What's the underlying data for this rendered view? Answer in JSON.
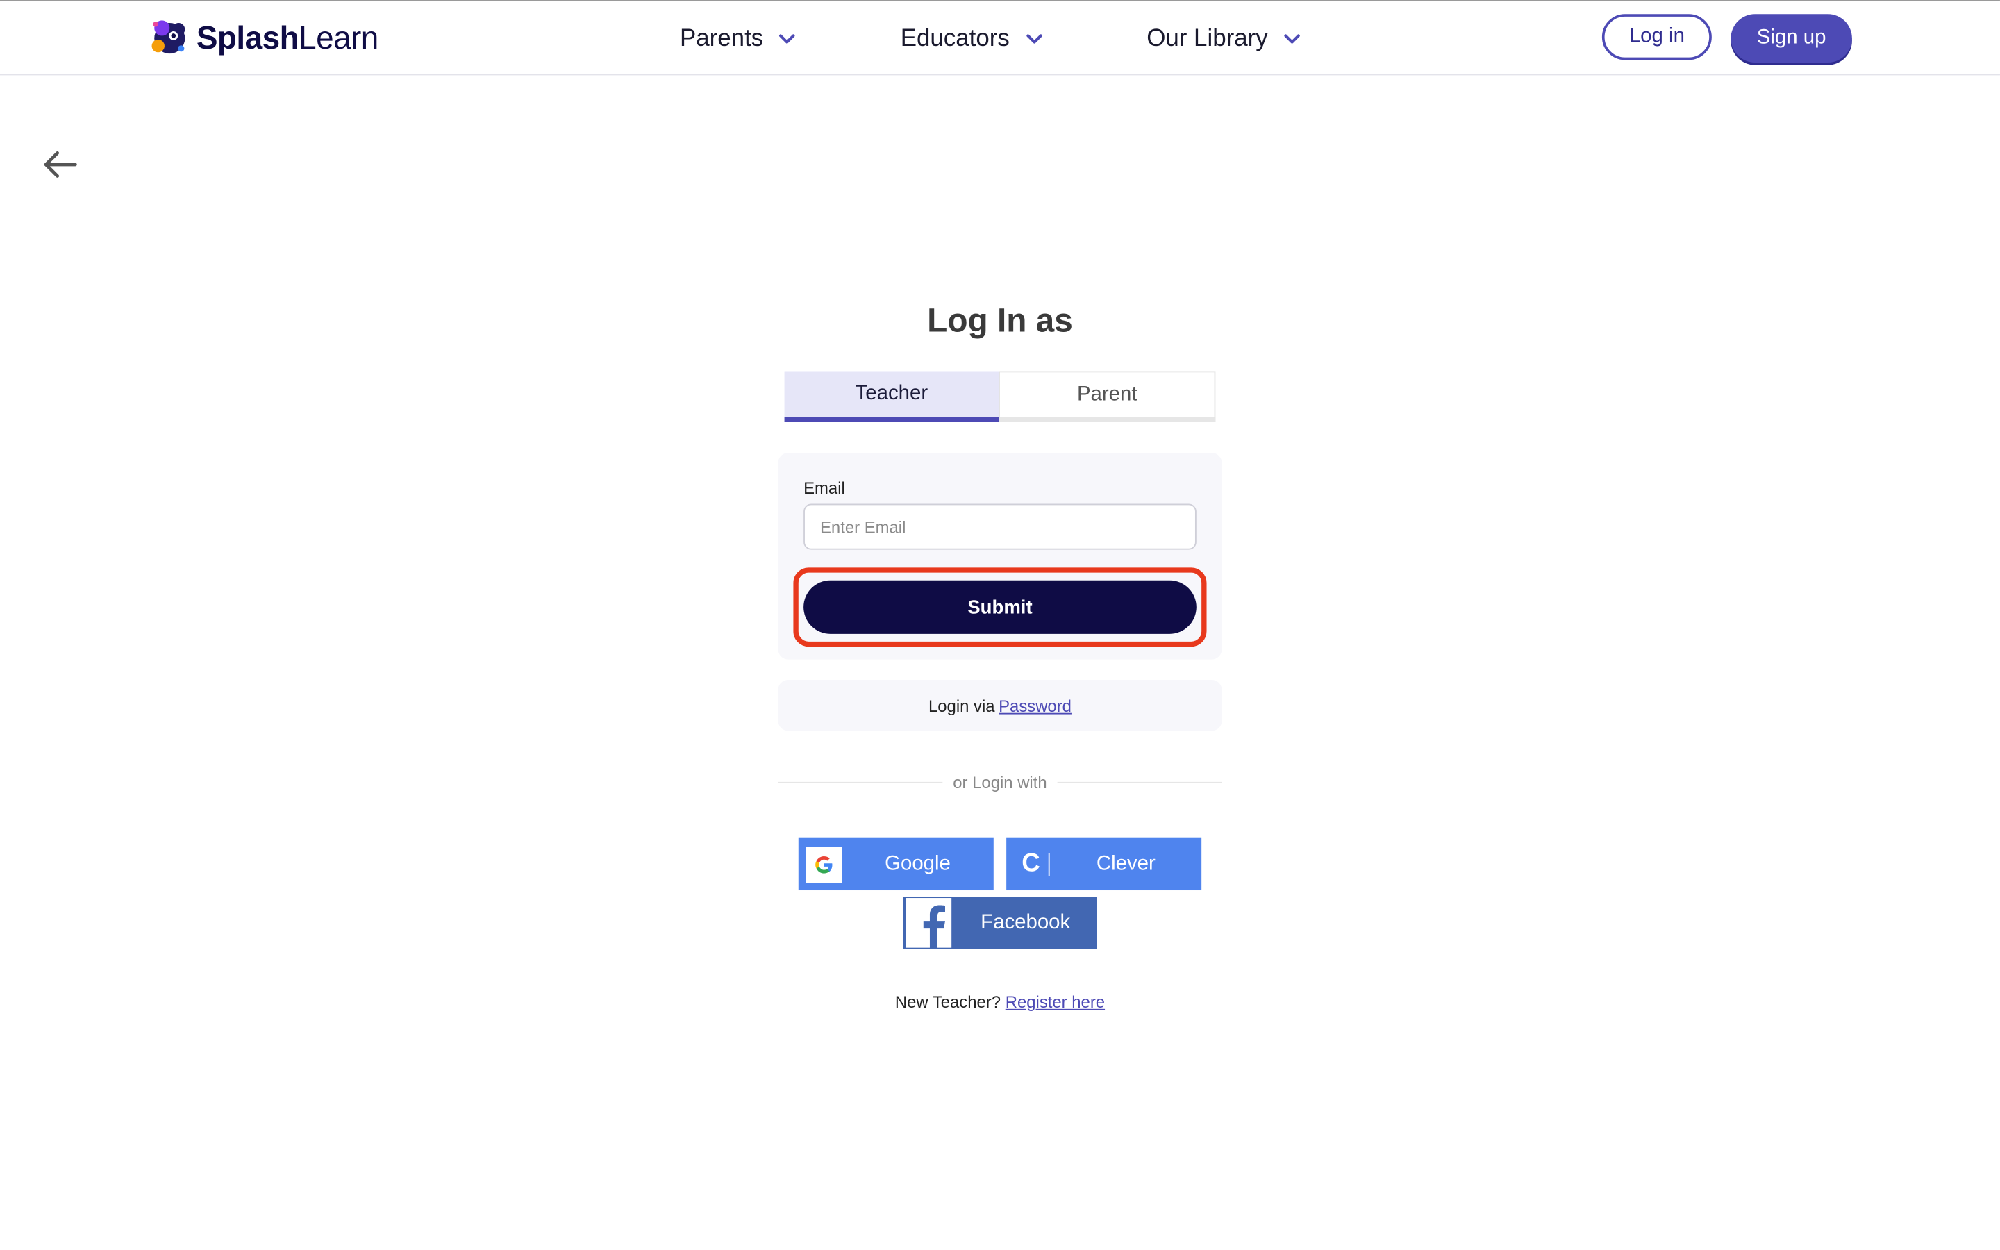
{
  "header": {
    "logo": {
      "bold": "Splash",
      "regular": "Learn"
    },
    "nav": [
      {
        "label": "Parents"
      },
      {
        "label": "Educators"
      },
      {
        "label": "Our Library"
      }
    ],
    "login_label": "Log in",
    "signup_label": "Sign up"
  },
  "login": {
    "title": "Log In as",
    "tabs": [
      {
        "label": "Teacher",
        "active": true
      },
      {
        "label": "Parent",
        "active": false
      }
    ],
    "email_label": "Email",
    "email_placeholder": "Enter Email",
    "email_value": "",
    "submit_label": "Submit",
    "password_prefix": "Login via",
    "password_link": "Password",
    "divider_text": "or Login with",
    "social": {
      "google": "Google",
      "clever": "Clever",
      "facebook": "Facebook"
    },
    "register_prefix": "New Teacher?",
    "register_link": "Register here"
  },
  "colors": {
    "brand": "#4d4ab5",
    "submit": "#0f0c45",
    "highlight": "#e8391d",
    "google": "#4f84ee",
    "clever": "#4f84ee",
    "facebook": "#4267b2"
  }
}
